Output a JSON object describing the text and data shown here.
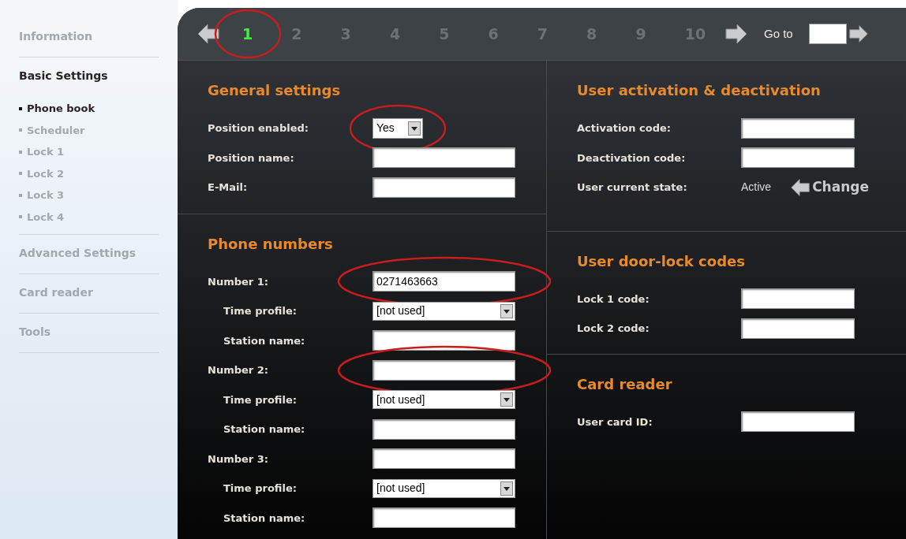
{
  "sidebar": {
    "items": [
      {
        "label": "Information",
        "selected": false
      },
      {
        "label": "Basic Settings",
        "selected": true,
        "children": [
          {
            "label": "Phone book",
            "selected": true
          },
          {
            "label": "Scheduler",
            "selected": false
          },
          {
            "label": "Lock 1",
            "selected": false
          },
          {
            "label": "Lock 2",
            "selected": false
          },
          {
            "label": "Lock 3",
            "selected": false
          },
          {
            "label": "Lock 4",
            "selected": false
          }
        ]
      },
      {
        "label": "Advanced Settings",
        "selected": false
      },
      {
        "label": "Card reader",
        "selected": false
      },
      {
        "label": "Tools",
        "selected": false
      }
    ]
  },
  "pager": {
    "pages": [
      {
        "label": "1",
        "selected": true,
        "annotated": true
      },
      {
        "label": "2",
        "selected": false,
        "annotated": false
      },
      {
        "label": "3",
        "selected": false,
        "annotated": false
      },
      {
        "label": "4",
        "selected": false,
        "annotated": false
      },
      {
        "label": "5",
        "selected": false,
        "annotated": false
      },
      {
        "label": "6",
        "selected": false,
        "annotated": false
      },
      {
        "label": "7",
        "selected": false,
        "annotated": false
      },
      {
        "label": "8",
        "selected": false,
        "annotated": false
      },
      {
        "label": "9",
        "selected": false,
        "annotated": false
      },
      {
        "label": "10",
        "selected": false,
        "annotated": false
      }
    ],
    "goto_label": "Go to"
  },
  "left_sections": [
    {
      "title": "General settings",
      "fields": [
        {
          "kind": "yes_no",
          "label": "Position enabled:",
          "value": "Yes",
          "annotated": true
        },
        {
          "kind": "text",
          "label": "Position name:",
          "annotated": false
        },
        {
          "kind": "text",
          "label": "E-Mail:",
          "annotated": false
        }
      ]
    },
    {
      "title": "Phone numbers",
      "fields": [
        {
          "kind": "text",
          "label": "Number 1:",
          "value": "0271463663",
          "annotated": true,
          "children": [
            {
              "kind": "select",
              "label": "Time profile:",
              "value": "[not used]",
              "annotated": false
            },
            {
              "kind": "text",
              "label": "Station name:",
              "annotated": false
            }
          ]
        },
        {
          "kind": "text",
          "label": "Number 2:",
          "annotated": true,
          "children": [
            {
              "kind": "select",
              "label": "Time profile:",
              "value": "[not used]",
              "annotated": false
            },
            {
              "kind": "text",
              "label": "Station name:",
              "annotated": false
            }
          ]
        },
        {
          "kind": "text",
          "label": "Number 3:",
          "annotated": false,
          "children": [
            {
              "kind": "select",
              "label": "Time profile:",
              "value": "[not used]",
              "annotated": false
            },
            {
              "kind": "text",
              "label": "Station name:",
              "annotated": false
            }
          ]
        }
      ]
    }
  ],
  "right_sections": [
    {
      "title": "User activation & deactivation",
      "fields": [
        {
          "kind": "text",
          "label": "Activation code:",
          "annotated": false
        },
        {
          "kind": "text",
          "label": "Deactivation code:",
          "annotated": false
        },
        {
          "kind": "state",
          "label": "User current state:",
          "value": "Active",
          "action": "Change",
          "annotated": false
        }
      ]
    },
    {
      "title": "User door-lock codes",
      "fields": [
        {
          "kind": "text",
          "label": "Lock 1 code:",
          "annotated": false
        },
        {
          "kind": "text",
          "label": "Lock 2 code:",
          "annotated": false
        }
      ]
    },
    {
      "title": "Card reader",
      "fields": [
        {
          "kind": "text",
          "label": "User card ID:",
          "annotated": false
        }
      ]
    }
  ]
}
